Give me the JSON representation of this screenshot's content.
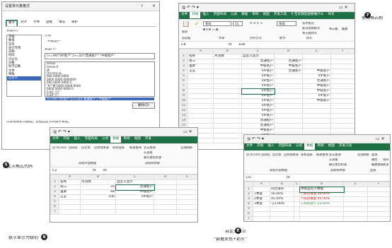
{
  "dialog": {
    "title": "设置单元格格式",
    "help": "?",
    "close": "×",
    "tabs": [
      "数字",
      "对齐",
      "字体",
      "边框",
      "填充",
      "保护"
    ],
    "category_label": "分类(C):",
    "categories": [
      "常规",
      "数值",
      "货币",
      "会计专用",
      "日期",
      "时间",
      "百分比",
      "分数",
      "科学记数",
      "文本",
      "特殊",
      "自定义"
    ],
    "sample_label": "示例",
    "sample_value": "中级客户",
    "type_label": "类型(T):",
    "type_value": "[>=99]\"VIP客户\";[>=50]\"普通客户\";\"中级客户\"",
    "codes": [
      "mmss",
      "mmss.0",
      "@",
      "[h]:mm:ss",
      "000 0000 0000",
      "0000 0000 0000000",
      "000 0000 0000 0",
      "\"¥\"\"零\"0000 0000 0000",
      "0000 0000 0000 0",
      "0.00_\"万\"",
      "0.00\"万\"",
      "[>=99]\"VIP客户\";[>=50]\"普通客户\";\"中级客户\""
    ],
    "delete_btn": "删除(D)",
    "hint": "以现有格式为基础，生成自定义的数字格式。",
    "ok_btn": "确定",
    "cancel_btn": "取消"
  },
  "steps": {
    "s5": {
      "num": "5",
      "text": "自定义格式代码"
    },
    "s6": {
      "num": "6",
      "text": "数字显示为级别"
    },
    "s7": {
      "num": "7",
      "text": "使用格式刷"
    },
    "s8": {
      "num": "8",
      "line1": "自定义显示",
      "line2": "“数据变色+箭头”"
    }
  },
  "excel_top": {
    "ribbon_tabs": [
      "文件",
      "开始",
      "插入",
      "页面布局",
      "公式",
      "数据",
      "审阅",
      "视图",
      "开发工具"
    ],
    "tell_me": "♀ 告诉我您想要做什么",
    "share": "共享",
    "ribbon_items": [
      "粘贴",
      "剪贴板",
      "字体",
      "对齐方式",
      "数字",
      "条件格式",
      "套用表格格式",
      "单元格样式",
      "样式",
      "单元格",
      "编辑"
    ],
    "font_name": "等线",
    "font_size": "11",
    "number_format": "常规",
    "cell_ref": "C8",
    "fx": "fx",
    "formula": "108",
    "cols": [
      "A",
      "B",
      "C",
      "D",
      "E",
      "F"
    ],
    "rows": [
      {
        "n": "1",
        "a": "名称",
        "b": "月消费",
        "c": "自定义显示",
        "d": "",
        "e": ""
      },
      {
        "n": "2",
        "a": "张三",
        "b": "",
        "c": "普通客户",
        "d": "普通客户",
        "e": ""
      },
      {
        "n": "3",
        "a": "里斯",
        "b": "",
        "c": "中级客户",
        "d": "中级客户",
        "e": ""
      },
      {
        "n": "4",
        "a": "王五",
        "b": "",
        "c": "VIP客户",
        "d": "普通客户",
        "e": "中级客户"
      },
      {
        "n": "5",
        "a": "",
        "b": "",
        "c": "VIP客户",
        "d": "",
        "e": "VIP客户"
      },
      {
        "n": "6",
        "a": "",
        "b": "",
        "c": "VIP客户",
        "d": "",
        "e": "普通客户"
      },
      {
        "n": "7",
        "a": "",
        "b": "",
        "c": "VIP客户",
        "d": "",
        "e": "中级客户"
      },
      {
        "n": "8",
        "a": "",
        "b": "",
        "c": "VIP客户",
        "d": "",
        "e": "中级客户"
      },
      {
        "n": "9",
        "a": "",
        "b": "",
        "c": "VIP客户",
        "d": "",
        "e": "VIP客户"
      },
      {
        "n": "10",
        "a": "",
        "b": "",
        "c": "VIP客户",
        "d": "",
        "e": "中级客户"
      },
      {
        "n": "11",
        "a": "",
        "b": "",
        "c": "VIP客户",
        "d": "",
        "e": ""
      },
      {
        "n": "12",
        "a": "",
        "b": "",
        "c": "VIP客户",
        "d": "",
        "e": ""
      },
      {
        "n": "13",
        "a": "",
        "b": "",
        "c": "VIP客户",
        "d": "",
        "e": ""
      },
      {
        "n": "14",
        "a": "",
        "b": "",
        "c": "普通客户",
        "d": "",
        "e": ""
      },
      {
        "n": "15",
        "a": "",
        "b": "",
        "c": "普通客户",
        "d": "",
        "e": ""
      },
      {
        "n": "16",
        "a": "",
        "b": "",
        "c": "中级客户",
        "d": "",
        "e": ""
      },
      {
        "n": "17",
        "a": "",
        "b": "",
        "c": "VIP客户",
        "d": "",
        "e": ""
      },
      {
        "n": "18",
        "a": "",
        "b": "",
        "c": "",
        "d": "",
        "e": ""
      }
    ]
  },
  "excel_mid": {
    "ribbon_tabs": [
      "文件",
      "开始",
      "插入",
      "页面布局",
      "公式",
      "数据",
      "审阅",
      "视图",
      "开发"
    ],
    "ribbon_items": [
      "自 Access",
      "自网站",
      "自文本",
      "自其他来源",
      "现有连接",
      "新建查询",
      "显示查询",
      "从表格",
      "最近使用的源",
      "全部刷新",
      "获取外部数据",
      "获取和转换"
    ],
    "cell_ref": "C2",
    "fx": "fx",
    "formula": "35",
    "cols": [
      "A",
      "B",
      "C",
      "D",
      "E"
    ],
    "rows": [
      {
        "n": "1",
        "a": "名称",
        "b": "月消费",
        "c": "自定义显示"
      },
      {
        "n": "2",
        "a": "张三",
        "b": "35",
        "c": "普通客户"
      },
      {
        "n": "3",
        "a": "里斯",
        "b": "68",
        "c": "中级客户"
      },
      {
        "n": "4",
        "a": "王五",
        "b": "106",
        "c": "VIP客户"
      },
      {
        "n": "5",
        "a": "",
        "b": "",
        "c": ""
      },
      {
        "n": "6",
        "a": "",
        "b": "",
        "c": ""
      },
      {
        "n": "7",
        "a": "",
        "b": "",
        "c": ""
      }
    ]
  },
  "excel_br": {
    "ribbon_tabs": [
      "文件",
      "开始",
      "插入",
      "页面布局",
      "公式",
      "数据",
      "审阅",
      "视图",
      "开发工具"
    ],
    "ribbon_items": [
      "自 Access",
      "自网站",
      "自文本",
      "自其他来源",
      "现有连接",
      "新建查询",
      "显示查询",
      "从表格",
      "最近使用的源",
      "全部刷新",
      "连接",
      "属性",
      "编辑链接",
      "排序",
      "筛选",
      "获取外部数据",
      "获取和转换",
      "连接"
    ],
    "cell_ref": "D1",
    "fx": "fx",
    "formula": "",
    "cols": [
      "A",
      "B",
      "C",
      "D",
      "E",
      "F"
    ],
    "rows": [
      {
        "n": "1",
        "a": "",
        "b": "同比增长",
        "c": "",
        "d": "添加自定义数据"
      },
      {
        "n": "2",
        "a": "1季度",
        "b": "56.00%",
        "c": "",
        "d": "↑同比增加 56.00%"
      },
      {
        "n": "3",
        "a": "2季度",
        "b": "45.00%",
        "c": "",
        "d": "↑同比增加 45.00%"
      },
      {
        "n": "4",
        "a": "3季度",
        "b": "-23.00%",
        "c": "",
        "d": "↓同比减少 23.00%"
      },
      {
        "n": "5",
        "a": "",
        "b": "",
        "c": "",
        "d": ""
      },
      {
        "n": "6",
        "a": "",
        "b": "",
        "c": "",
        "d": ""
      },
      {
        "n": "7",
        "a": "",
        "b": "",
        "c": "",
        "d": ""
      },
      {
        "n": "8",
        "a": "",
        "b": "",
        "c": "",
        "d": ""
      },
      {
        "n": "9",
        "a": "",
        "b": "",
        "c": "",
        "d": ""
      },
      {
        "n": "10",
        "a": "",
        "b": "",
        "c": "",
        "d": ""
      }
    ]
  }
}
